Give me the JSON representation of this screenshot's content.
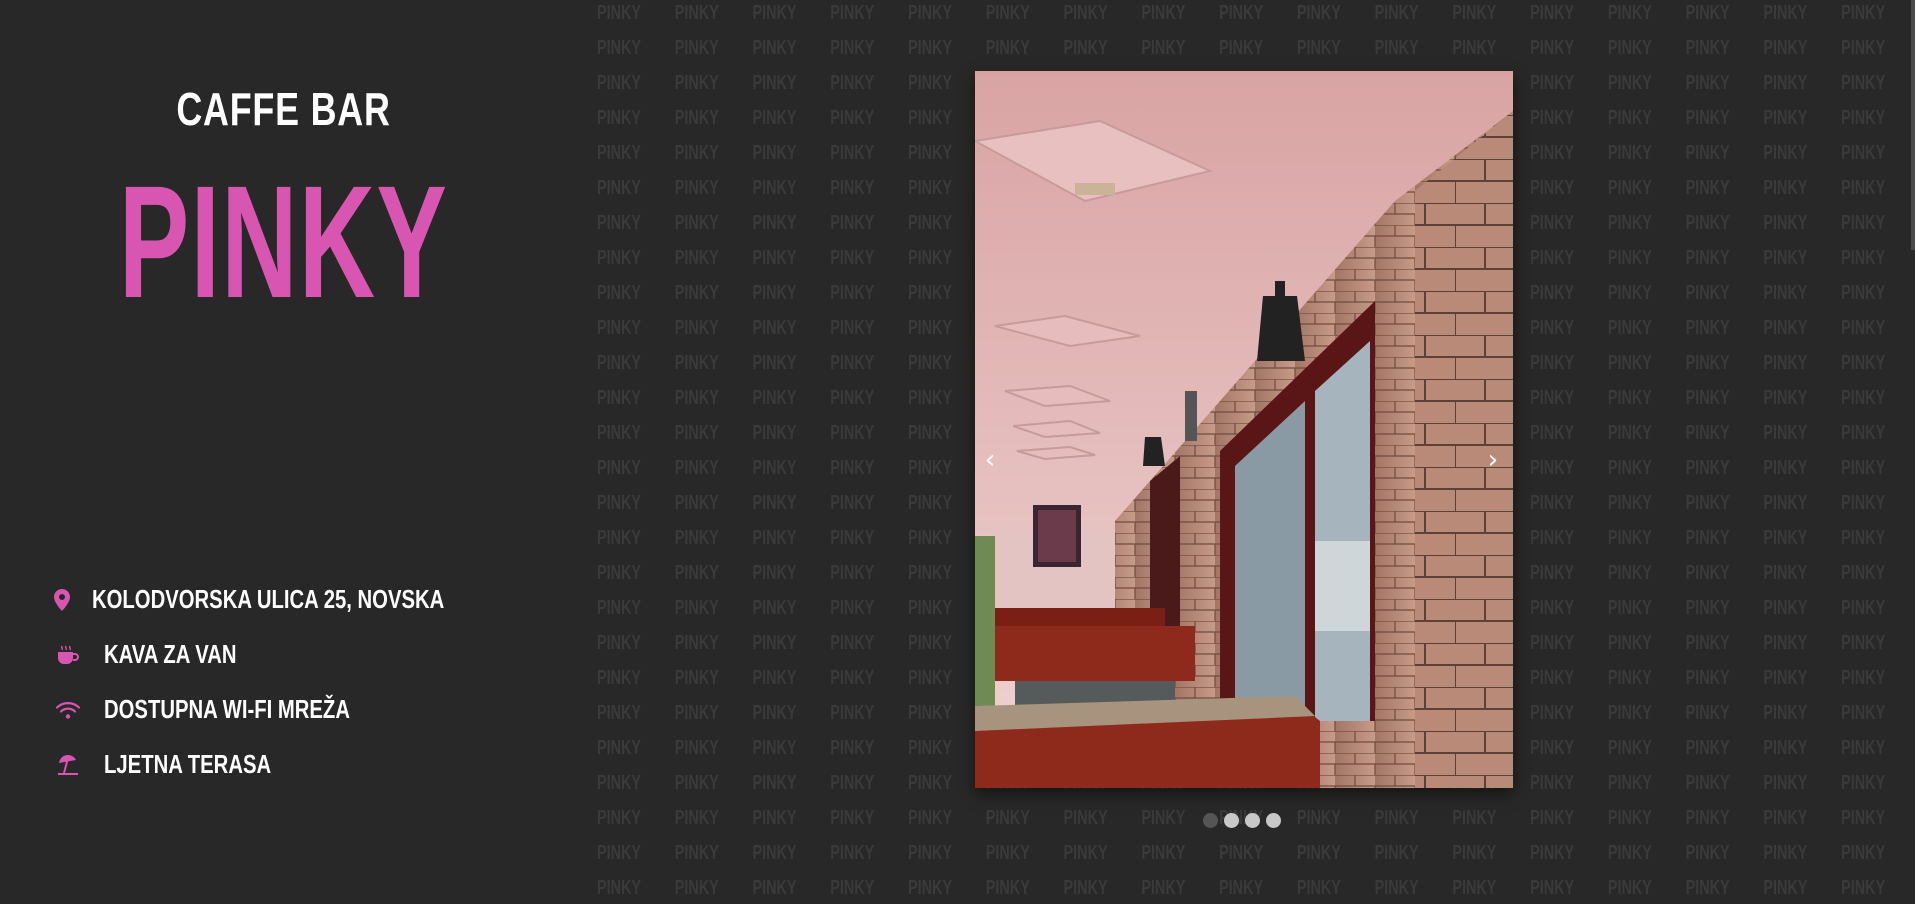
{
  "brand": {
    "subtitle": "CAFFE BAR",
    "title": "PINKY"
  },
  "background": {
    "watermark_word": "PINKY"
  },
  "features": [
    {
      "icon": "location-pin-icon",
      "label": "KOLODVORSKA ULICA 25, NOVSKA"
    },
    {
      "icon": "coffee-cup-icon",
      "label": "KAVA ZA VAN"
    },
    {
      "icon": "wifi-icon",
      "label": "DOSTUPNA WI-FI MREŽA"
    },
    {
      "icon": "beach-umbrella-icon",
      "label": "LJETNA TERASA"
    }
  ],
  "carousel": {
    "prev_symbol": "‹",
    "next_symbol": "›",
    "slide_count": 4,
    "active_index": 0
  },
  "colors": {
    "accent": "#d855b2",
    "background": "#282828",
    "text": "#ffffff"
  }
}
